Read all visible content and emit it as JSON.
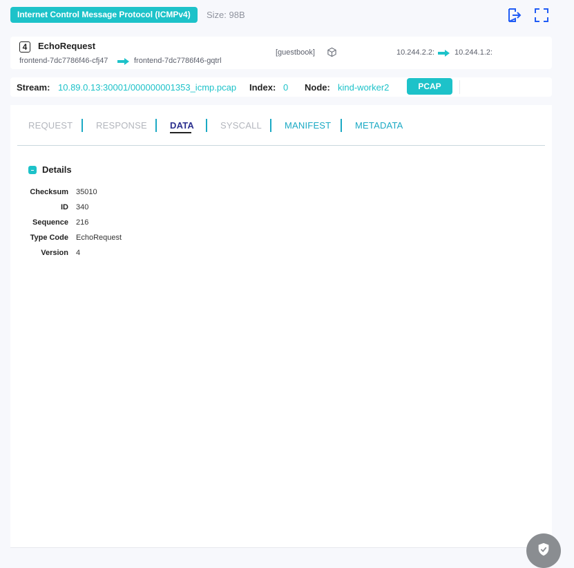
{
  "header": {
    "protocol_badge": "Internet Control Message Protocol (ICMPv4)",
    "size": "Size: 98B",
    "icons": [
      "panel-toggle-icon",
      "fullscreen-icon"
    ]
  },
  "entry": {
    "number": "4",
    "title": "EchoRequest",
    "source_pod": "frontend-7dc7786f46-cfj47",
    "dest_pod": "frontend-7dc7786f46-gqtrl",
    "namespace": "[guestbook]",
    "source_ip": "10.244.2.2:",
    "dest_ip": "10.244.1.2:"
  },
  "stream_row": {
    "stream_label": "Stream:",
    "stream_value": "10.89.0.13:30001/000000001353_icmp.pcap",
    "index_label": "Index:",
    "index_value": "0",
    "node_label": "Node:",
    "node_value": "kind-worker2",
    "pcap_button": "PCAP"
  },
  "tabs": [
    {
      "label": "REQUEST",
      "state": "disabled"
    },
    {
      "label": "RESPONSE",
      "state": "disabled"
    },
    {
      "label": "DATA",
      "state": "active"
    },
    {
      "label": "SYSCALL",
      "state": "disabled"
    },
    {
      "label": "MANIFEST",
      "state": "link"
    },
    {
      "label": "METADATA",
      "state": "link"
    }
  ],
  "details": {
    "title": "Details",
    "fields": [
      {
        "key": "Checksum",
        "value": "35010"
      },
      {
        "key": "ID",
        "value": "340"
      },
      {
        "key": "Sequence",
        "value": "216"
      },
      {
        "key": "Type Code",
        "value": "EchoRequest"
      },
      {
        "key": "Version",
        "value": "4"
      }
    ]
  },
  "colors": {
    "accent": "#1dc2c9",
    "link": "#1aa9c4",
    "icon_blue": "#205cf5"
  }
}
